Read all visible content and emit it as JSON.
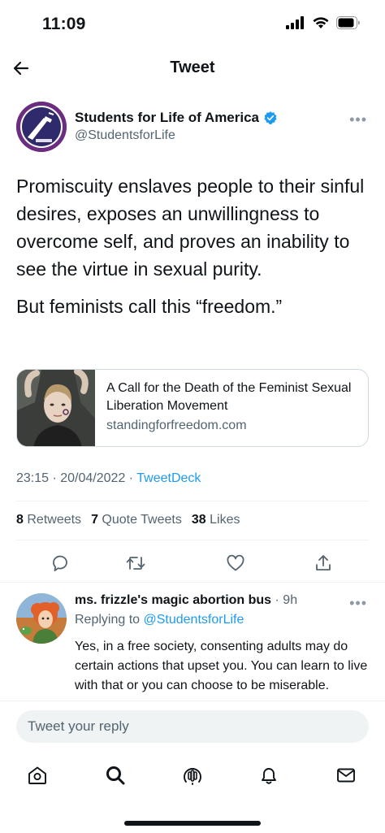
{
  "status_bar": {
    "time": "11:09"
  },
  "nav": {
    "title": "Tweet"
  },
  "tweet": {
    "author_name": "Students for Life of America",
    "author_handle": "@StudentsforLife",
    "paragraphs": [
      "Promiscuity enslaves people to their sinful desires, exposes an unwillingness to overcome self, and proves an inability to see the virtue in sexual purity.",
      "But feminists call this “freedom.”"
    ],
    "card": {
      "title": "A Call for the Death of the Feminist Sexual Liberation Movement",
      "domain": "standingforfreedom.com"
    },
    "meta": {
      "datetime": "23:15 · 20/04/2022 · ",
      "source": "TweetDeck"
    },
    "stats": {
      "retweets_count": "8",
      "retweets_label": "Retweets",
      "quotes_count": "7",
      "quotes_label": "Quote Tweets",
      "likes_count": "38",
      "likes_label": "Likes"
    }
  },
  "reply": {
    "author_name": "ms. frizzle's magic abortion bus",
    "time": " · 9h",
    "replying_label": "Replying to ",
    "replying_to": "@StudentsforLife",
    "text": "Yes, in a free society, consenting adults may do certain actions that upset you. You can learn to live with that or you can choose to be miserable."
  },
  "compose": {
    "placeholder": "Tweet your reply"
  },
  "icons": {
    "verified": "verified-badge-icon",
    "accent": "#1d9bf0"
  }
}
